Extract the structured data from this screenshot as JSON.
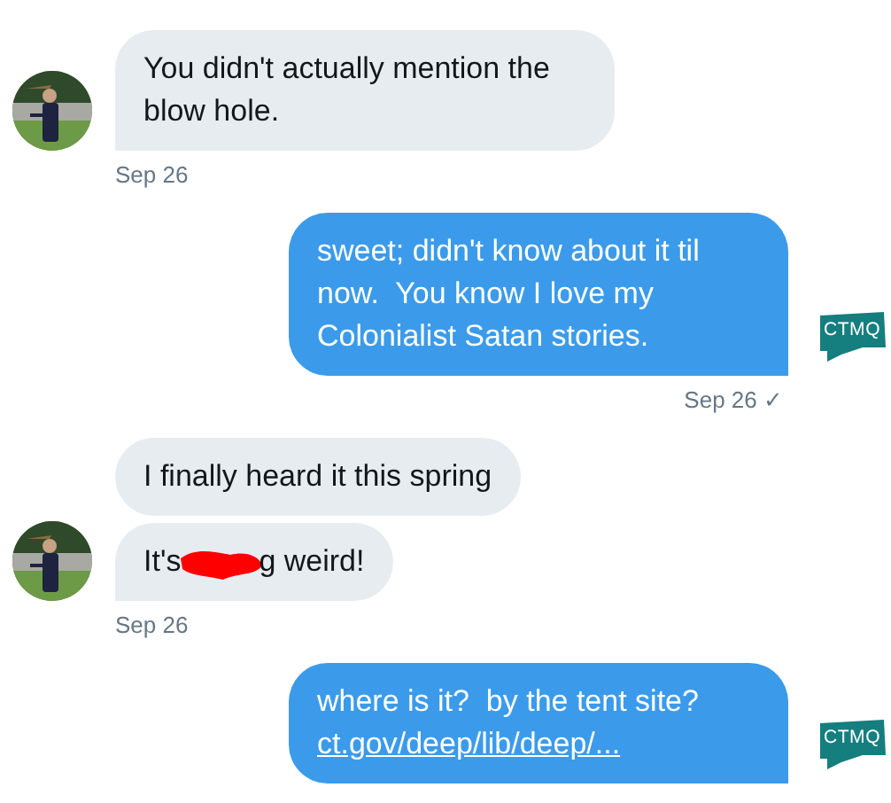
{
  "messages": [
    {
      "kind": "incoming",
      "bubbles": [
        {
          "parts": [
            {
              "kind": "text",
              "text": "You didn't actually mention the blow hole."
            }
          ]
        }
      ],
      "time": "Sep 26"
    },
    {
      "kind": "outgoing",
      "avatar_label": "CTMQ",
      "bubbles": [
        {
          "parts": [
            {
              "kind": "text",
              "text": "sweet; didn't know about it til now.  You know I love my Colonialist Satan stories."
            }
          ]
        }
      ],
      "time": "Sep 26",
      "status": "✓"
    },
    {
      "kind": "incoming",
      "bubbles": [
        {
          "parts": [
            {
              "kind": "text",
              "text": "I finally heard it this spring"
            }
          ]
        },
        {
          "parts": [
            {
              "kind": "text",
              "text": "It's"
            },
            {
              "kind": "scribble"
            },
            {
              "kind": "text",
              "text": "g weird!"
            }
          ]
        }
      ],
      "time": "Sep 26"
    },
    {
      "kind": "outgoing",
      "avatar_label": "CTMQ",
      "bubbles": [
        {
          "parts": [
            {
              "kind": "text",
              "text": "where is it?  by the tent site? "
            },
            {
              "kind": "link",
              "text": "ct.gov/deep/lib/deep/..."
            }
          ]
        }
      ]
    }
  ]
}
